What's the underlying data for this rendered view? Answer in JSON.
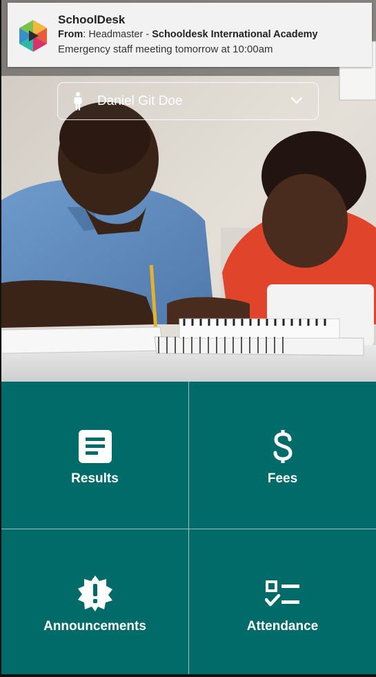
{
  "notification": {
    "app_name": "SchoolDesk",
    "from_label": "From",
    "from_sender": "Headmaster",
    "separator": "-",
    "from_school": "Schooldesk International Academy",
    "message": "Emergency staff meeting tomorrow at 10:00am"
  },
  "selector": {
    "user_name": "Daniel Git Doe",
    "icon": "person-icon",
    "dropdown_icon": "chevron-down-icon"
  },
  "tiles": {
    "results": {
      "label": "Results",
      "icon": "document-icon"
    },
    "fees": {
      "label": "Fees",
      "icon": "dollar-icon"
    },
    "announcements": {
      "label": "Announcements",
      "icon": "alert-badge-icon"
    },
    "attendance": {
      "label": "Attendance",
      "icon": "checklist-icon"
    }
  },
  "colors": {
    "tile_background": "#016b6a",
    "tile_divider": "#9fbfbf",
    "notification_background": "#f2f2f2"
  }
}
